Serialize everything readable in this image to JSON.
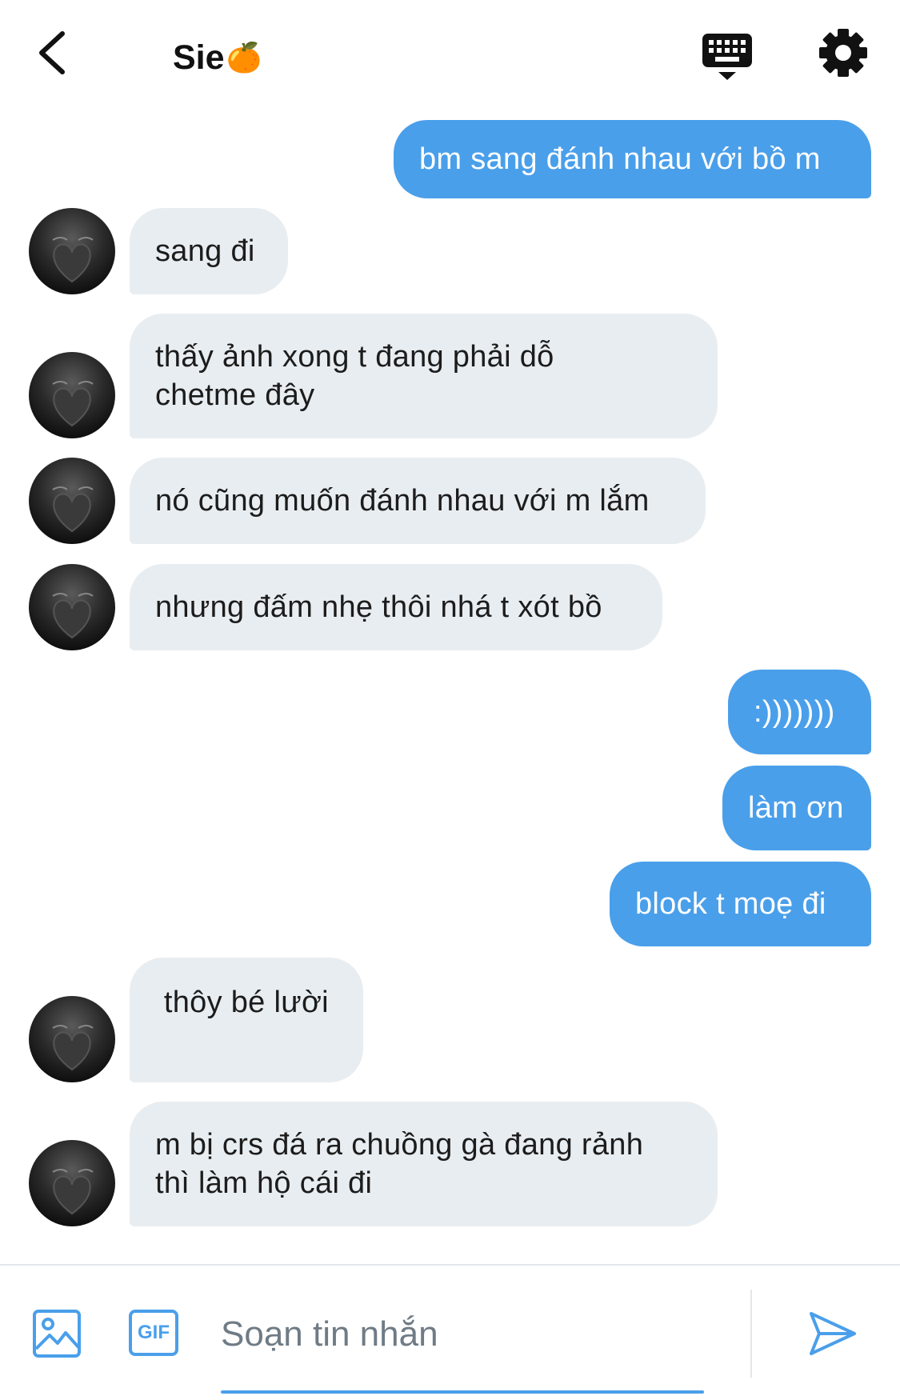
{
  "header": {
    "title": "Sie",
    "title_emoji": "🍊",
    "back_icon": "chevron-left-icon",
    "keyboard_icon": "keyboard-icon",
    "settings_icon": "gear-icon"
  },
  "messages": [
    {
      "sender": "me",
      "text": "bm sang đánh nhau với bồ m"
    },
    {
      "sender": "them",
      "text": "sang đi"
    },
    {
      "sender": "them",
      "text": "thấy ảnh xong t đang phải dỗ\nchetme đây"
    },
    {
      "sender": "them",
      "text": "nó cũng muốn đánh nhau với m lắm"
    },
    {
      "sender": "them",
      "text": "nhưng đấm nhẹ thôi nhá t xót bồ"
    },
    {
      "sender": "me",
      "text": ":)))))))"
    },
    {
      "sender": "me",
      "text": "làm ơn"
    },
    {
      "sender": "me",
      "text": "block t moẹ đi"
    },
    {
      "sender": "them",
      "text": " thôy bé lười"
    },
    {
      "sender": "them",
      "text": "m bị crs đá ra chuồng gà đang rảnh\nthì làm hộ cái đi"
    }
  ],
  "composer": {
    "placeholder": "Soạn tin nhắn",
    "gif_label": "GIF",
    "image_icon": "image-icon",
    "send_icon": "send-icon"
  },
  "colors": {
    "accent": "#4a9fea",
    "incoming_bubble": "#e8edf1",
    "text_dark": "#1c1c1c"
  }
}
